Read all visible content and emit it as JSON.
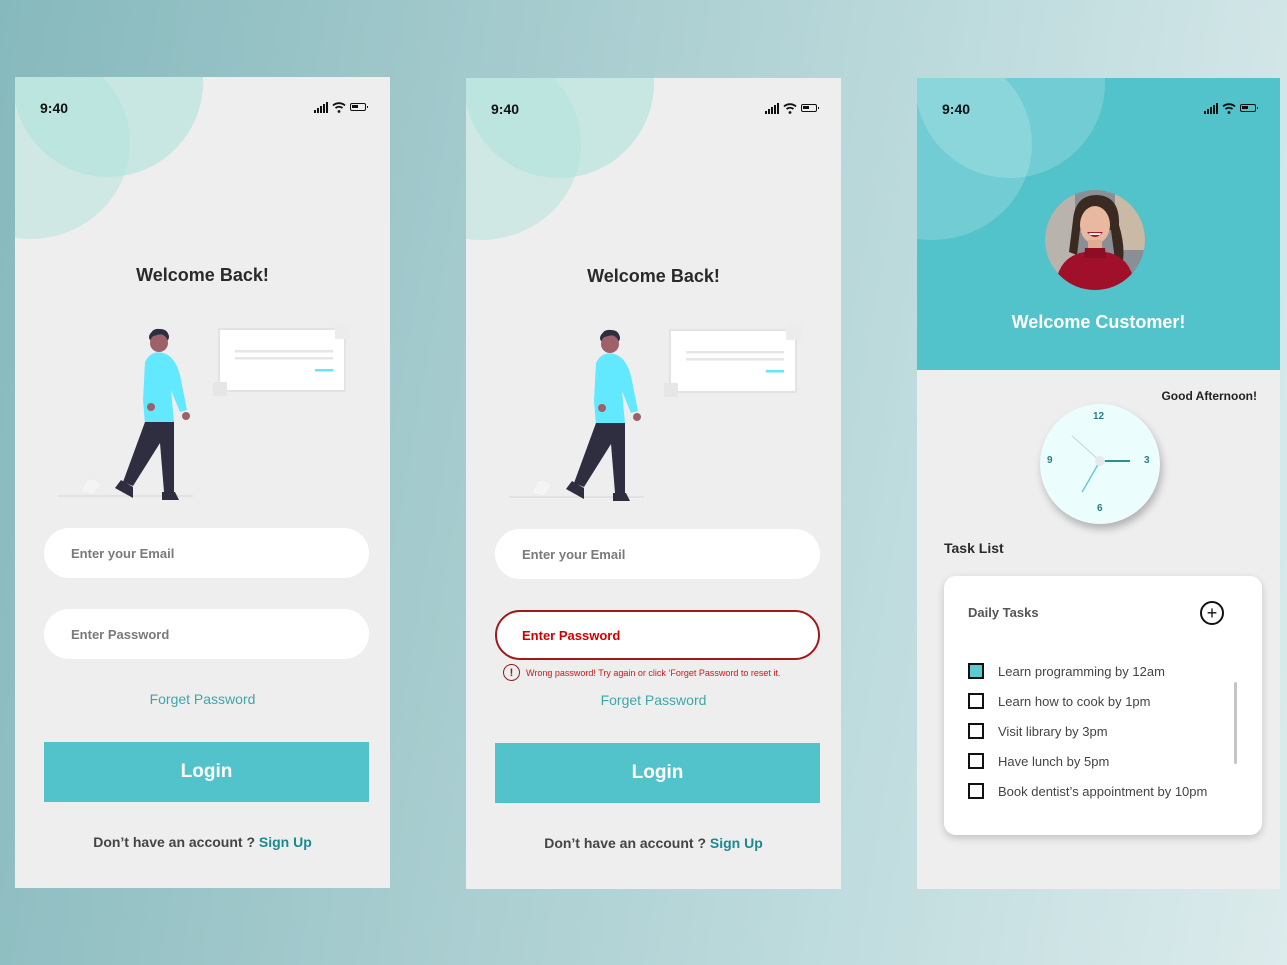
{
  "colors": {
    "accent": "#52c3ca",
    "link": "#3fa6a8",
    "signup_link": "#1a8a90",
    "error": "#d40000",
    "error_border": "#9e1a1a",
    "screen_bg": "#eeeeee"
  },
  "statusbar": {
    "time": "9:40",
    "icons": [
      "signal-icon",
      "wifi-icon",
      "battery-icon"
    ]
  },
  "login_screen": {
    "title": "Welcome Back!",
    "email_placeholder": "Enter your  Email",
    "password_placeholder": "Enter Password",
    "forget_password": "Forget Password",
    "login_button": "Login",
    "signup_prompt": "Don’t have an account ? ",
    "signup_link": "Sign Up"
  },
  "login_error_screen": {
    "title": "Welcome Back!",
    "email_placeholder": "Enter your  Email",
    "password_placeholder": "Enter Password",
    "error_icon": "!",
    "error_message": "Wrong password! Try again or click ‘Forget Password to reset it.",
    "forget_password": "Forget Password",
    "login_button": "Login",
    "signup_prompt": "Don’t have an account ? ",
    "signup_link": "Sign Up"
  },
  "dashboard_screen": {
    "welcome": "Welcome Customer!",
    "greeting": "Good Afternoon!",
    "clock": {
      "numbers": [
        "12",
        "3",
        "6",
        "9"
      ],
      "hour": 3,
      "minute": 35,
      "second": 52
    },
    "task_list_heading": "Task List",
    "card_title": "Daily Tasks",
    "add_icon": "+",
    "tasks": [
      {
        "label": "Learn programming by 12am",
        "checked": true
      },
      {
        "label": "Learn how to cook by 1pm",
        "checked": false
      },
      {
        "label": "Visit library by 3pm",
        "checked": false
      },
      {
        "label": "Have lunch by 5pm",
        "checked": false
      },
      {
        "label": "Book dentist’s appointment by 10pm",
        "checked": false
      }
    ]
  }
}
